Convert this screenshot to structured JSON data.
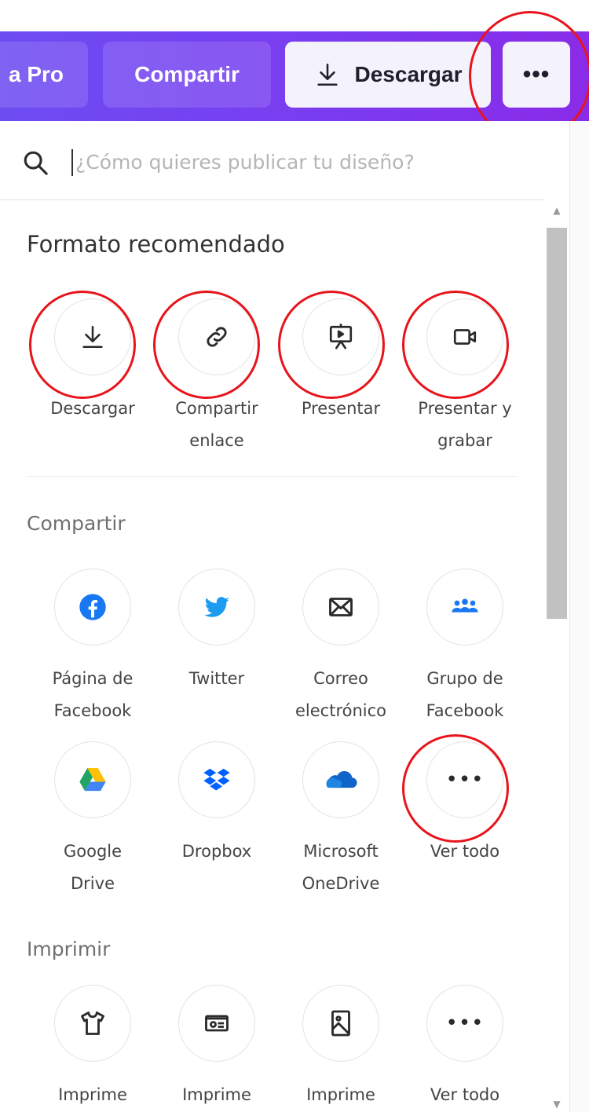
{
  "toolbar": {
    "pro_label": "a Pro",
    "share_label": "Compartir",
    "download_label": "Descargar",
    "more_label": "•••"
  },
  "search": {
    "placeholder": "¿Cómo quieres publicar tu diseño?"
  },
  "recommended": {
    "title": "Formato recomendado",
    "items": [
      {
        "icon": "download-icon",
        "label_line1": "Descargar",
        "label_line2": ""
      },
      {
        "icon": "link-icon",
        "label_line1": "Compartir",
        "label_line2": "enlace"
      },
      {
        "icon": "present-icon",
        "label_line1": "Presentar",
        "label_line2": ""
      },
      {
        "icon": "video-camera-icon",
        "label_line1": "Presentar y",
        "label_line2": "grabar"
      }
    ]
  },
  "share": {
    "title": "Compartir",
    "items": [
      {
        "icon": "facebook-icon",
        "label_line1": "Página de",
        "label_line2": "Facebook"
      },
      {
        "icon": "twitter-icon",
        "label_line1": "Twitter",
        "label_line2": ""
      },
      {
        "icon": "email-icon",
        "label_line1": "Correo",
        "label_line2": "electrónico"
      },
      {
        "icon": "facebook-group-icon",
        "label_line1": "Grupo de",
        "label_line2": "Facebook"
      },
      {
        "icon": "google-drive-icon",
        "label_line1": "Google",
        "label_line2": "Drive"
      },
      {
        "icon": "dropbox-icon",
        "label_line1": "Dropbox",
        "label_line2": ""
      },
      {
        "icon": "onedrive-icon",
        "label_line1": "Microsoft",
        "label_line2": "OneDrive"
      },
      {
        "icon": "more-icon",
        "label_line1": "Ver todo",
        "label_line2": "",
        "more_symbol": "•••"
      }
    ]
  },
  "print": {
    "title": "Imprimir",
    "items": [
      {
        "icon": "tshirt-icon",
        "label_line1": "Imprime",
        "label_line2": ""
      },
      {
        "icon": "card-icon",
        "label_line1": "Imprime",
        "label_line2": ""
      },
      {
        "icon": "photo-print-icon",
        "label_line1": "Imprime",
        "label_line2": ""
      },
      {
        "icon": "more-icon",
        "label_line1": "Ver todo",
        "label_line2": "",
        "more_symbol": "•••"
      }
    ]
  },
  "colors": {
    "toolbar_start": "#6d4cf2",
    "toolbar_end": "#8a2be8",
    "highlight": "#e8141b",
    "facebook": "#1877f2",
    "twitter": "#1d9bf0",
    "dropbox": "#0061fe",
    "onedrive": "#0f64c8"
  }
}
